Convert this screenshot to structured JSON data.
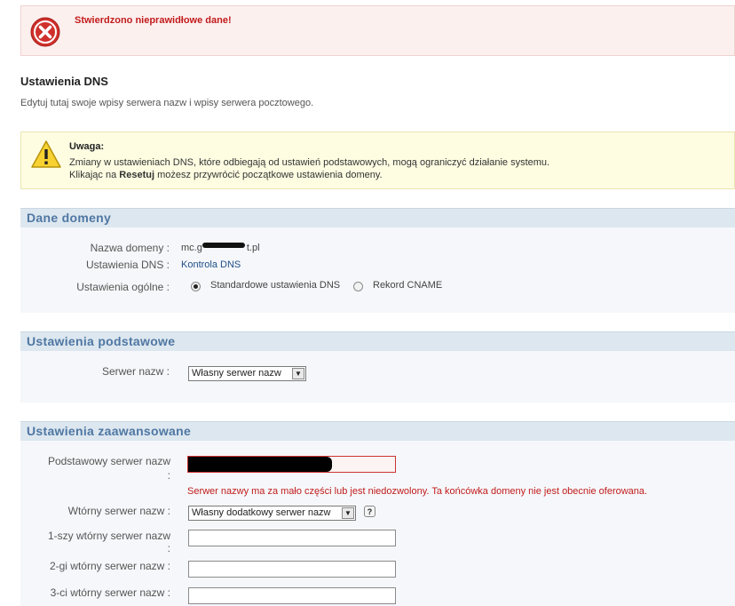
{
  "error": {
    "message": "Stwierdzono nieprawidłowe dane!"
  },
  "page": {
    "title": "Ustawienia DNS",
    "description": "Edytuj tutaj swoje wpisy serwera nazw i wpisy serwera pocztowego."
  },
  "warning": {
    "title": "Uwaga:",
    "line1": "Zmiany w ustawieniach DNS, które odbiegają od ustawień podstawowych, mogą ograniczyć działanie systemu.",
    "line2_pre": "Klikając na ",
    "line2_bold": "Resetuj",
    "line2_post": " możesz przywrócić początkowe ustawienia domeny."
  },
  "domain_section": {
    "header": "Dane domeny",
    "domain_label": "Nazwa domeny :",
    "domain_value": "mc.g",
    "domain_value_end": "t.pl",
    "dns_label": "Ustawienia DNS :",
    "dns_link": "Kontrola DNS",
    "general_label": "Ustawienia ogólne :",
    "radio_standard": "Standardowe ustawienia DNS",
    "radio_cname": "Rekord CNAME"
  },
  "basic_section": {
    "header": "Ustawienia podstawowe",
    "ns_label": "Serwer nazw :",
    "ns_value": "Własny serwer nazw"
  },
  "advanced_section": {
    "header": "Ustawienia zaawansowane",
    "primary_label": "Podstawowy serwer nazw",
    "primary_colon": ":",
    "primary_error": "Serwer nazwy ma za mało części lub jest niedozwolony. Ta końcówka domeny nie jest obecnie oferowana.",
    "secondary_label": "Wtórny serwer nazw :",
    "secondary_value": "Własny dodatkowy serwer nazw",
    "help": "?",
    "first_label": "1-szy wtórny serwer nazw",
    "first_colon": ":",
    "second_label": "2-gi wtórny serwer nazw :",
    "third_label": "3-ci wtórny serwer nazw :"
  },
  "colors": {
    "error": "#c21b1b",
    "section_header": "#4f77a3",
    "link": "#1f4f8a"
  }
}
